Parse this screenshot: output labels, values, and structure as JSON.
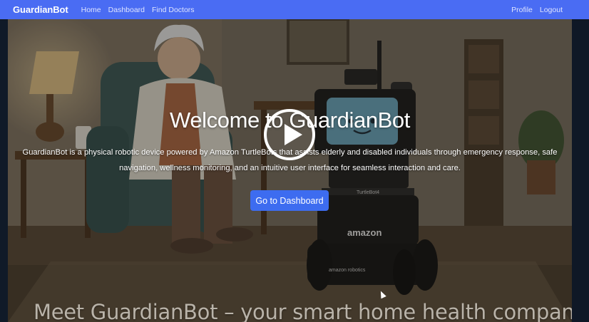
{
  "navbar": {
    "brand": "GuardianBot",
    "links": [
      {
        "label": "Home"
      },
      {
        "label": "Dashboard"
      },
      {
        "label": "Find Doctors"
      }
    ],
    "right_links": [
      {
        "label": "Profile"
      },
      {
        "label": "Logout"
      }
    ],
    "background": "#4a6cf3"
  },
  "hero": {
    "title": "Welcome to GuardianBot",
    "description": "GuardianBot is a physical robotic device powered by Amazon TurtleBots that assists elderly and disabled individuals through emergency response, safe navigation, wellness monitoring, and an intuitive user interface for seamless interaction and care.",
    "cta_label": "Go to Dashboard",
    "cta_color": "#3d6cf0",
    "play_icon": "play-icon"
  },
  "video": {
    "robot_label": "TurtleBot4",
    "robot_brand": "amazon",
    "base_brand": "amazon robotics",
    "tagline": "Meet GuardianBot – your smart home health companion."
  }
}
